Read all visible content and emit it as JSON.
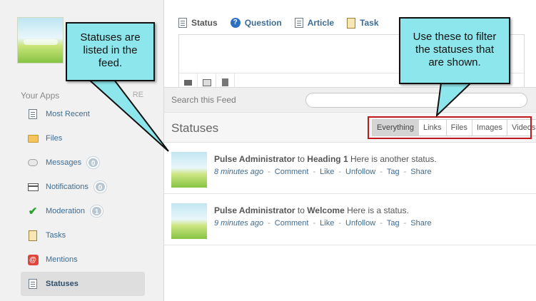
{
  "sidebar": {
    "apps_header": "Your Apps",
    "more_label": "RE",
    "items": [
      {
        "label": "Most Recent",
        "icon": "recent-icon",
        "count": ""
      },
      {
        "label": "Files",
        "icon": "folder-icon",
        "count": ""
      },
      {
        "label": "Messages",
        "icon": "message-icon",
        "count": "0"
      },
      {
        "label": "Notifications",
        "icon": "notification-icon",
        "count": "0"
      },
      {
        "label": "Moderation",
        "icon": "check-icon",
        "count": "1"
      },
      {
        "label": "Tasks",
        "icon": "clipboard-icon",
        "count": ""
      },
      {
        "label": "Mentions",
        "icon": "at-icon",
        "count": ""
      },
      {
        "label": "Statuses",
        "icon": "status-icon",
        "count": ""
      }
    ]
  },
  "composer": {
    "tabs": [
      {
        "label": "Status",
        "icon": "status-icon"
      },
      {
        "label": "Question",
        "icon": "question-icon"
      },
      {
        "label": "Article",
        "icon": "article-icon"
      },
      {
        "label": "Task",
        "icon": "task-icon"
      }
    ],
    "tools": [
      "video-icon",
      "image-icon",
      "file-icon"
    ]
  },
  "search": {
    "label": "Search this Feed",
    "placeholder": ""
  },
  "feed": {
    "title": "Statuses",
    "filters": [
      "Everything",
      "Links",
      "Files",
      "Images",
      "Videos"
    ],
    "active_filter": "Everything",
    "statuses": [
      {
        "author": "Pulse Administrator",
        "to_word": "to",
        "target": "Heading 1",
        "text": "Here is another status.",
        "time": "8 minutes ago",
        "actions": [
          "Comment",
          "Like",
          "Unfollow",
          "Tag",
          "Share"
        ]
      },
      {
        "author": "Pulse Administrator",
        "to_word": "to",
        "target": "Welcome",
        "text": "Here is a status.",
        "time": "9 minutes ago",
        "actions": [
          "Comment",
          "Like",
          "Unfollow",
          "Tag",
          "Share"
        ]
      }
    ]
  },
  "callouts": {
    "left": {
      "line1": "Statuses are",
      "line2": "listed in the",
      "line3": "feed."
    },
    "right": {
      "line1": "Use these to filter",
      "line2": "the statuses that",
      "line3": "are shown."
    }
  },
  "colors": {
    "link": "#3e6c93",
    "callout": "#8de6eb",
    "highlight_border": "#c0181d",
    "active_filter": "#d4d4d4"
  }
}
